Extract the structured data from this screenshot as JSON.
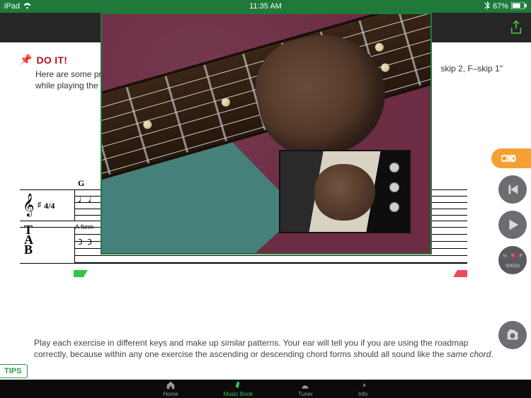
{
  "status": {
    "carrier": "iPad",
    "time": "11:35 AM",
    "battery": "67%"
  },
  "section": {
    "heading": "DO IT!",
    "intro_line1": "Here are some pra",
    "intro_line2": "while playing the a",
    "intro_right_frag": "skip 2, F–skip 1\""
  },
  "score": {
    "chord": "G",
    "time_sig": "4/4",
    "form_label": "A form",
    "tab_frets": "3   3"
  },
  "para": {
    "t1": "Play each exercise in different keys and make up similar patterns. Your ear will tell you if you are using the roadmap correctly, because within any one exercise the ascending or descending chord forms should all sound like the ",
    "italic": "same chord",
    "t2": "."
  },
  "tips_label": "TIPS",
  "controls": {
    "speed_label": "SPEED",
    "speed_half": "½",
    "speed_3q": "¾",
    "speed_full": "F"
  },
  "tabs": {
    "home": "Home",
    "book": "Music Book",
    "tuner": "Tuner",
    "info": "Info"
  }
}
